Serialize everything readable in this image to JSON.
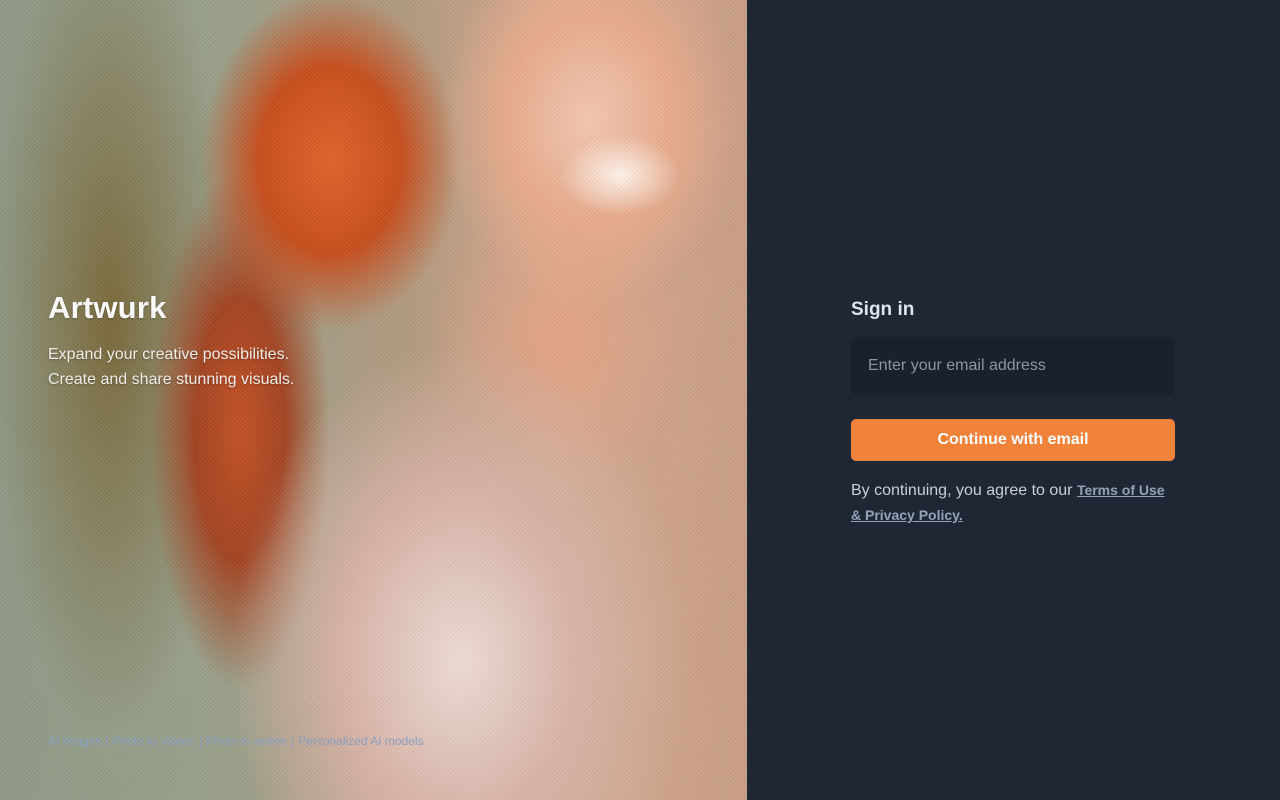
{
  "hero": {
    "brand": "Artwurk",
    "tagline_line1": "Expand your creative possibilities.",
    "tagline_line2": "Create and share stunning visuals.",
    "footer_links": [
      "AI images",
      "Photo to videos",
      "Photo to anime",
      "Personalized AI models"
    ],
    "footer_separator": "|"
  },
  "signin": {
    "title": "Sign in",
    "email_placeholder": "Enter your email address",
    "email_value": "",
    "continue_label": "Continue with email",
    "legal_prefix": "By continuing, you agree to our",
    "legal_link": "Terms of Use & Privacy Policy."
  },
  "colors": {
    "background": "#1f2735",
    "input_bg": "#1a212c",
    "accent": "#f1823a",
    "link": "#93a2b8"
  }
}
